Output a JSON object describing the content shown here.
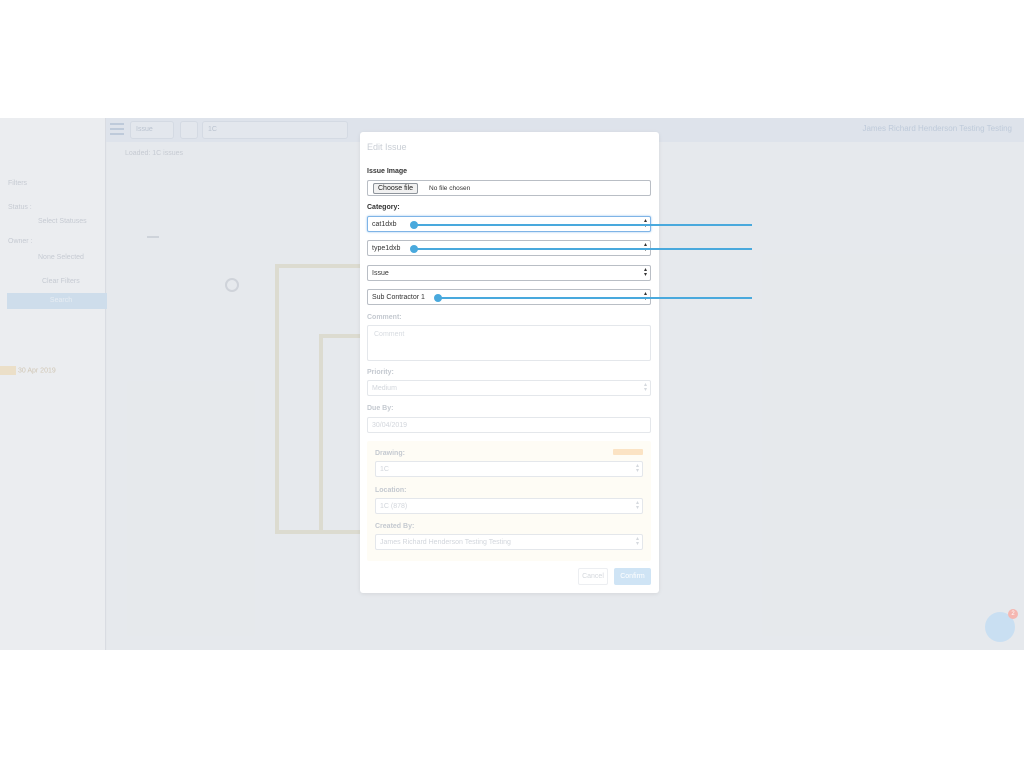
{
  "app": {
    "topbar": {
      "select_small": "Issue",
      "select_zoom": "",
      "select_drawing": "1C",
      "user_name": "James Richard Henderson Testing Testing"
    },
    "sidebar": {
      "filter_label": "Filters",
      "status_label": "Status :",
      "status_value": "Select Statuses",
      "owner_label": "Owner :",
      "owner_value": "None Selected",
      "clear_label": "Clear Filters",
      "search_button": "Search",
      "issue_date": "30 Apr 2019"
    },
    "content": {
      "breadcrumb": "Loaded: 1C issues"
    }
  },
  "modal": {
    "title": "Edit Issue",
    "issue_image_label": "Issue Image",
    "file_button": "Choose file",
    "file_status": "No file chosen",
    "category_label": "Category:",
    "category_value": "cat1dxb",
    "type_value": "type1dxb",
    "issue_value": "Issue",
    "subcontractor_value": "Sub Contractor 1",
    "comment_label": "Comment:",
    "comment_placeholder": "Comment",
    "priority_label": "Priority:",
    "priority_value": "Medium",
    "due_label": "Due By:",
    "due_value": "30/04/2019",
    "drawing_label": "Drawing:",
    "drawing_value": "1C",
    "location_label": "Location:",
    "location_value": "1C (878)",
    "created_label": "Created By:",
    "created_value": "James Richard Henderson Testing Testing",
    "cancel_label": "Cancel",
    "confirm_label": "Confirm"
  },
  "colors": {
    "pointer": "#49a9dd",
    "confirm": "#cfe4f5"
  }
}
